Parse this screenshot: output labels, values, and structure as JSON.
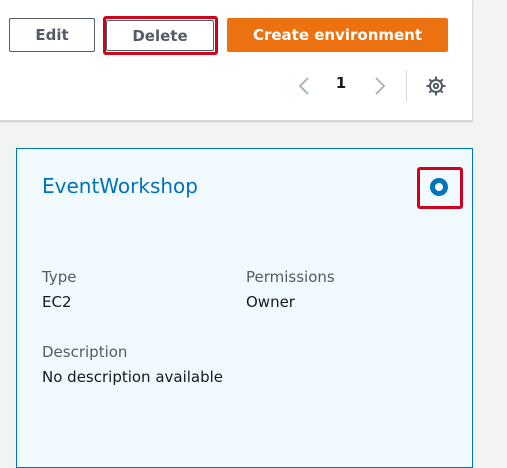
{
  "toolbar": {
    "edit_label": "Edit",
    "delete_label": "Delete",
    "create_label": "Create environment"
  },
  "pagination": {
    "current_page": "1",
    "prev_icon": "chevron-left-icon",
    "next_icon": "chevron-right-icon",
    "settings_icon": "gear-icon"
  },
  "card": {
    "title": "EventWorkshop",
    "selected": true,
    "fields": {
      "type_label": "Type",
      "type_value": "EC2",
      "permissions_label": "Permissions",
      "permissions_value": "Owner",
      "description_label": "Description",
      "description_value": "No description available"
    }
  },
  "colors": {
    "accent": "#ec7211",
    "link": "#0073bb",
    "highlight": "#d0021b",
    "card_background": "#f1faff"
  }
}
